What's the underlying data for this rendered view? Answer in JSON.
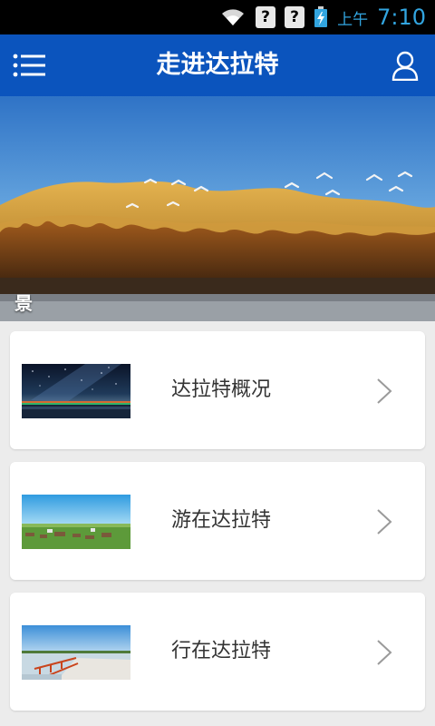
{
  "statusbar": {
    "wifi_icon": "wifi-icon",
    "sim1_icon": "unknown-sim-icon",
    "sim2_icon": "unknown-sim-icon",
    "battery_icon": "battery-charging-icon",
    "ampm": "上午",
    "time": "7:10",
    "q1": "?",
    "q2": "?"
  },
  "header": {
    "title": "走进达拉特",
    "menu_icon": "list-menu-icon",
    "user_icon": "user-icon",
    "color": "#0b54bd"
  },
  "banner": {
    "caption": "景"
  },
  "menu": {
    "items": [
      {
        "label": "达拉特概况",
        "thumb": "night-sky-thumbnail"
      },
      {
        "label": "游在达拉特",
        "thumb": "grassland-thumbnail"
      },
      {
        "label": "行在达拉特",
        "thumb": "lake-pier-thumbnail"
      }
    ]
  }
}
